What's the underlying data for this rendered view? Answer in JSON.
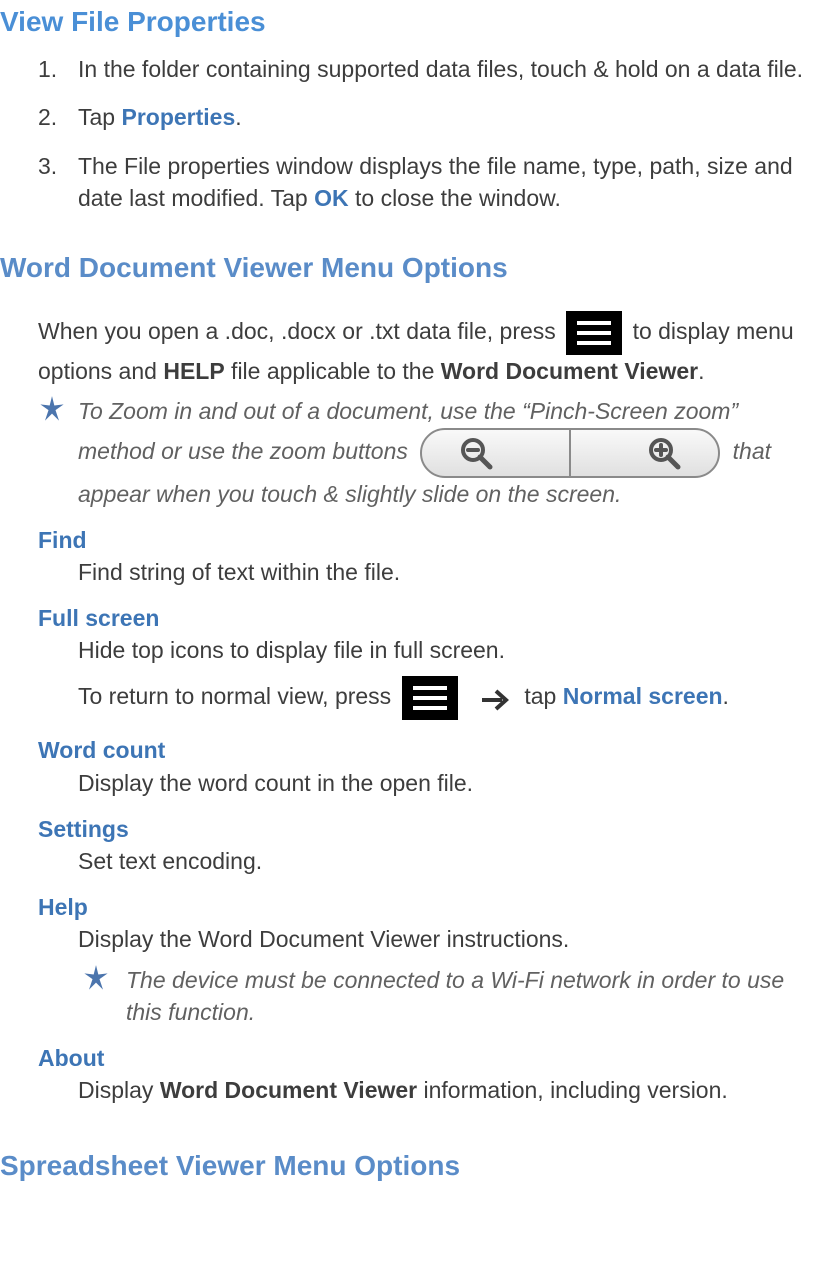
{
  "section1": {
    "heading": "View File Properties",
    "steps": [
      {
        "num": "1.",
        "text_a": "In the folder containing supported data files, touch & hold on a data file."
      },
      {
        "num": "2.",
        "text_a": "Tap ",
        "link": "Properties",
        "text_b": "."
      },
      {
        "num": "3.",
        "text_a": "The File properties window displays the file name, type, path, size and date last modified. Tap ",
        "link": "OK",
        "text_b": " to close the window."
      }
    ]
  },
  "section2": {
    "heading": "Word Document Viewer Menu Options",
    "intro": {
      "a": "When you open a .doc, .docx or .txt data file, press ",
      "b": " to display menu options and ",
      "help": "HELP",
      "c": " file applicable to the ",
      "wd": "Word Document Viewer",
      "d": "."
    },
    "note1": {
      "a": "To Zoom in and out of a document, use the “Pinch-Screen zoom” method or use the zoom buttons ",
      "b": " that appear when you touch & slightly slide on the screen."
    },
    "items": {
      "find": {
        "h": "Find",
        "d": "Find string of text within the file."
      },
      "fullscreen": {
        "h": "Full screen",
        "d1": "Hide top icons to display file in full screen.",
        "d2a": "To return to normal view, press ",
        "d2b": " tap ",
        "link": "Normal screen",
        "d2c": "."
      },
      "wordcount": {
        "h": "Word count",
        "d": "Display the word count in the open file."
      },
      "settings": {
        "h": "Settings",
        "d": "Set text encoding."
      },
      "help": {
        "h": "Help",
        "d": "Display the Word Document Viewer instructions.",
        "note": "The device must be connected to a Wi-Fi network in order to use this function."
      },
      "about": {
        "h": "About",
        "d1": "Display ",
        "bold": "Word Document Viewer",
        "d2": " information, including version."
      }
    }
  },
  "section3": {
    "heading": "Spreadsheet Viewer Menu Options"
  }
}
